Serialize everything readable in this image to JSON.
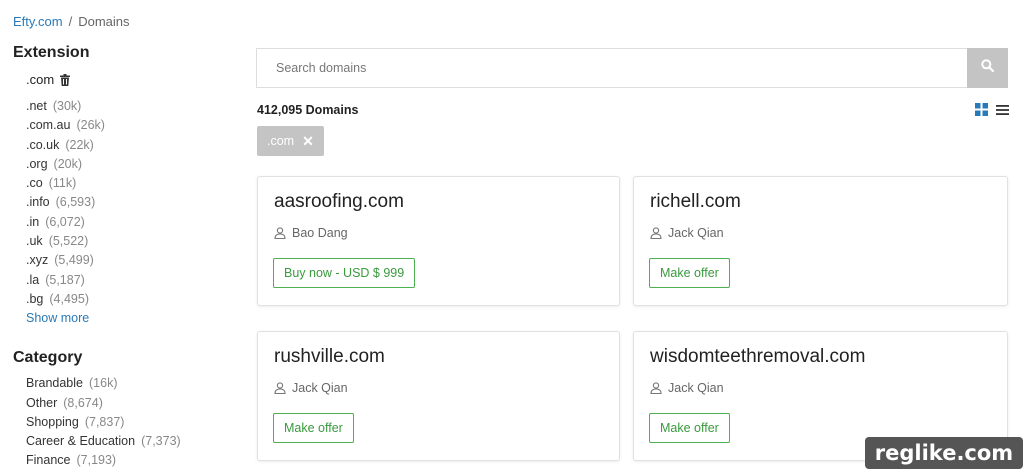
{
  "breadcrumb": {
    "home": "Efty.com",
    "separator": "/",
    "current": "Domains"
  },
  "sidebar": {
    "extension_heading": "Extension",
    "selected_extension": ".com",
    "extensions": [
      {
        "label": ".net",
        "count": "(30k)"
      },
      {
        "label": ".com.au",
        "count": "(26k)"
      },
      {
        "label": ".co.uk",
        "count": "(22k)"
      },
      {
        "label": ".org",
        "count": "(20k)"
      },
      {
        "label": ".co",
        "count": "(11k)"
      },
      {
        "label": ".info",
        "count": "(6,593)"
      },
      {
        "label": ".in",
        "count": "(6,072)"
      },
      {
        "label": ".uk",
        "count": "(5,522)"
      },
      {
        "label": ".xyz",
        "count": "(5,499)"
      },
      {
        "label": ".la",
        "count": "(5,187)"
      },
      {
        "label": ".bg",
        "count": "(4,495)"
      }
    ],
    "show_more": "Show more",
    "category_heading": "Category",
    "categories": [
      {
        "label": "Brandable",
        "count": "(16k)"
      },
      {
        "label": "Other",
        "count": "(8,674)"
      },
      {
        "label": "Shopping",
        "count": "(7,837)"
      },
      {
        "label": "Career & Education",
        "count": "(7,373)"
      },
      {
        "label": "Finance",
        "count": "(7,193)"
      }
    ]
  },
  "search": {
    "placeholder": "Search domains",
    "button_icon": "search-icon"
  },
  "results": {
    "count_label": "412,095 Domains"
  },
  "filter_chip": {
    "label": ".com",
    "remove_icon": "close-icon"
  },
  "view_toggle": {
    "grid_icon": "grid-icon",
    "list_icon": "list-icon",
    "active_color": "#2a7ab8"
  },
  "cards": [
    {
      "domain": "aasroofing.com",
      "owner": "Bao Dang",
      "action": "Buy now - USD $ 999"
    },
    {
      "domain": "richell.com",
      "owner": "Jack Qian",
      "action": "Make offer"
    },
    {
      "domain": "rushville.com",
      "owner": "Jack Qian",
      "action": "Make offer"
    },
    {
      "domain": "wisdomteethremoval.com",
      "owner": "Jack Qian",
      "action": "Make offer"
    }
  ],
  "watermark": "reglike.com",
  "colors": {
    "link": "#2a7ab8",
    "action_green": "#4caf50",
    "chip_bg": "#c4c4c4"
  }
}
